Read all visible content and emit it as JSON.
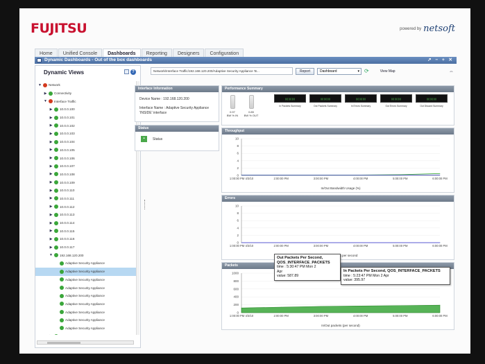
{
  "brand": {
    "name": "FUJITSU",
    "powered_by": "powered by",
    "partner": "netsoft"
  },
  "tabs": [
    "Home",
    "Unified Console",
    "Dashboards",
    "Reporting",
    "Designers",
    "Configuration"
  ],
  "window": {
    "title": "Dynamic Dashboards - Out of the box dashboards",
    "controls": "↗ − + ✕"
  },
  "sidebar": {
    "title": "Dynamic Views",
    "tree": [
      {
        "label": "Network",
        "indent": 0,
        "toggle": "▼",
        "status": "red"
      },
      {
        "label": "Connectivity",
        "indent": 1,
        "toggle": "▶",
        "status": "green"
      },
      {
        "label": "Interface Traffic",
        "indent": 1,
        "toggle": "▼",
        "status": "red"
      },
      {
        "label": "10.0.0.100",
        "indent": 2,
        "toggle": "▶",
        "status": "green"
      },
      {
        "label": "10.0.0.101",
        "indent": 2,
        "toggle": "▶",
        "status": "green"
      },
      {
        "label": "10.0.0.102",
        "indent": 2,
        "toggle": "▶",
        "status": "green"
      },
      {
        "label": "10.0.0.103",
        "indent": 2,
        "toggle": "▶",
        "status": "green"
      },
      {
        "label": "10.0.0.104",
        "indent": 2,
        "toggle": "▶",
        "status": "green"
      },
      {
        "label": "10.0.0.105",
        "indent": 2,
        "toggle": "▶",
        "status": "green"
      },
      {
        "label": "10.0.0.106",
        "indent": 2,
        "toggle": "▶",
        "status": "green"
      },
      {
        "label": "10.0.0.107",
        "indent": 2,
        "toggle": "▶",
        "status": "green"
      },
      {
        "label": "10.0.0.108",
        "indent": 2,
        "toggle": "▶",
        "status": "green"
      },
      {
        "label": "10.0.0.109",
        "indent": 2,
        "toggle": "▶",
        "status": "green"
      },
      {
        "label": "10.0.0.110",
        "indent": 2,
        "toggle": "▶",
        "status": "green"
      },
      {
        "label": "10.0.0.111",
        "indent": 2,
        "toggle": "▶",
        "status": "green"
      },
      {
        "label": "10.0.0.112",
        "indent": 2,
        "toggle": "▶",
        "status": "green"
      },
      {
        "label": "10.0.0.113",
        "indent": 2,
        "toggle": "▶",
        "status": "green"
      },
      {
        "label": "10.0.0.114",
        "indent": 2,
        "toggle": "▶",
        "status": "green"
      },
      {
        "label": "10.0.0.115",
        "indent": 2,
        "toggle": "▶",
        "status": "green"
      },
      {
        "label": "10.0.0.116",
        "indent": 2,
        "toggle": "▶",
        "status": "green"
      },
      {
        "label": "10.0.0.117",
        "indent": 2,
        "toggle": "▶",
        "status": "green"
      },
      {
        "label": "192.168.120.200",
        "indent": 2,
        "toggle": "▼",
        "status": "green"
      },
      {
        "label": "Adaptive Security Appliance",
        "indent": 3,
        "toggle": "",
        "status": "green"
      },
      {
        "label": "Adaptive Security Appliance",
        "indent": 3,
        "toggle": "",
        "status": "green",
        "selected": true
      },
      {
        "label": "Adaptive Security Appliance",
        "indent": 3,
        "toggle": "",
        "status": "green"
      },
      {
        "label": "Adaptive Security Appliance",
        "indent": 3,
        "toggle": "",
        "status": "green"
      },
      {
        "label": "Adaptive Security Appliance",
        "indent": 3,
        "toggle": "",
        "status": "green"
      },
      {
        "label": "Adaptive Security Appliance",
        "indent": 3,
        "toggle": "",
        "status": "green"
      },
      {
        "label": "Adaptive Security Appliance",
        "indent": 3,
        "toggle": "",
        "status": "green"
      },
      {
        "label": "Adaptive Security Appliance",
        "indent": 3,
        "toggle": "",
        "status": "green"
      },
      {
        "label": "Adaptive Security Appliance",
        "indent": 3,
        "toggle": "",
        "status": "green"
      },
      {
        "label": "192.168.120.8",
        "indent": 2,
        "toggle": "▶",
        "status": "green"
      }
    ]
  },
  "toolbar": {
    "path": "Network/Interface Traffic/192.168.120.200/Adaptive Security Appliance 'B...",
    "report_button": "Report",
    "dashboard_select": "Dashboard",
    "view_map": "View Map"
  },
  "interface_info": {
    "header": "Interface Information",
    "device_name": "Device Name :  192.168.120.200",
    "interface_name": "Interface Name : Adaptive Security Appliance 'INSIDE' interface"
  },
  "status_panel": {
    "header": "Status",
    "label": "Status"
  },
  "performance": {
    "header": "Performance Summary",
    "gauges": [
      {
        "label": "BW % IN",
        "value": "0.97"
      },
      {
        "label": "BW % OUT",
        "value": "0.85"
      }
    ],
    "lcds": [
      "In Packets Summary",
      "Out Packets Summary",
      "In Errors Summary",
      "Out Errors Summary",
      "Out Discard Summary"
    ]
  },
  "chart_data": [
    {
      "type": "line",
      "title": "Throughput",
      "xlabel": "In/Out Bandwidth Usage (%)",
      "x": [
        "1:00:00 PM 4/3/10",
        "2:00:00 PM",
        "3:00:00 PM",
        "4:00:00 PM",
        "5:00:00 PM",
        "6:00:00 PM"
      ],
      "yticks": [
        "0",
        "2",
        "4",
        "6",
        "8",
        "10"
      ],
      "ylim": [
        0,
        10
      ],
      "series": [
        {
          "color": "#3aa63a",
          "values": [
            0.1,
            0.1,
            0.1,
            0.1,
            0.2,
            0.5
          ]
        },
        {
          "color": "#5a5ad0",
          "values": [
            0.05,
            0.05,
            0.05,
            0.05,
            0.05,
            0.1
          ]
        }
      ]
    },
    {
      "type": "line",
      "title": "Errors",
      "xlabel": "In/Out errors per second",
      "x": [
        "1:00:00 PM 4/3/10",
        "2:00:00 PM",
        "3:00:00 PM",
        "4:00:00 PM",
        "5:00:00 PM",
        "6:00:00 PM"
      ],
      "yticks": [
        "0",
        "2",
        "4",
        "6",
        "8",
        "10"
      ],
      "ylim": [
        0,
        10
      ],
      "series": [
        {
          "color": "#3aa63a",
          "values": [
            0,
            0,
            0,
            0,
            0,
            0
          ]
        },
        {
          "color": "#5a5ad0",
          "values": [
            0,
            0,
            0,
            0,
            0,
            0
          ]
        }
      ]
    },
    {
      "type": "area",
      "title": "Packets",
      "xlabel": "In/Out packets (per second)",
      "x": [
        "1:00:00 PM 4/3/10",
        "2:00:00 PM",
        "3:00:00 PM",
        "4:00:00 PM",
        "5:00:00 PM",
        "6:00:00 PM"
      ],
      "yticks": [
        "0",
        "200",
        "400",
        "600",
        "800",
        "1000"
      ],
      "ylim": [
        0,
        1000
      ],
      "series": [
        {
          "color": "#3aa63a",
          "values": [
            120,
            140,
            160,
            170,
            180,
            190
          ]
        }
      ]
    }
  ],
  "tooltips": [
    {
      "title": "Out Packets Per Second,",
      "subtitle": "QOS_INTERFACE_PACKETS",
      "time": "time :  5:30:47 PM Mon 2",
      "time2": "Apr",
      "value": "value:  587.89"
    },
    {
      "title": "In Packets Per Second, QOS_INTERFACE_PACKETS",
      "time": "time :  5:23:47 PM Mon 2 Apr",
      "value": "value:  395.97"
    }
  ]
}
